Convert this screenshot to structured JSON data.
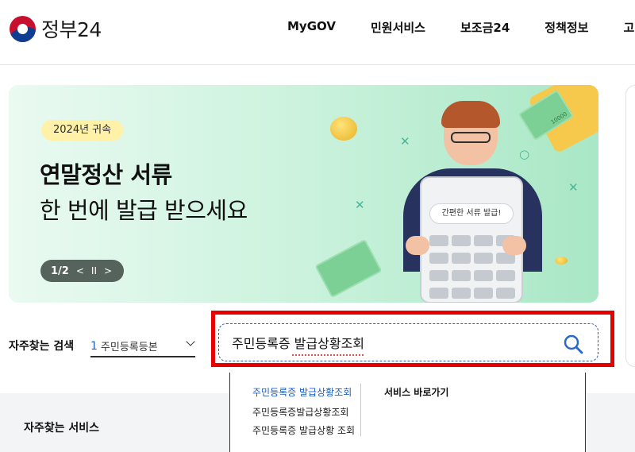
{
  "header": {
    "logo_text": "정부24",
    "nav": [
      "MyGOV",
      "민원서비스",
      "보조금24",
      "정책정보",
      "고"
    ]
  },
  "banner": {
    "badge": "2024년 귀속",
    "headline_bold": "연말정산 서류",
    "headline_regular": "한 번에 발급 받으세요",
    "pager": {
      "current": "1/2",
      "prev": "<",
      "pause": "II",
      "next": ">"
    },
    "calculator_text": "간편한 서류 발급!",
    "bill_value": "10000"
  },
  "search": {
    "frequent_label": "자주찾는 검색",
    "frequent_rank": "1",
    "frequent_value": "주민등록등본",
    "query": "주민등록증 발급상황조회",
    "highlight_color": "#e60000"
  },
  "dropdown": {
    "suggestions": [
      "주민등록증 발급상황조회",
      "주민등록증발급상황조회",
      "주민등록증 발급상황 조회"
    ],
    "shortcut_title": "서비스 바로가기"
  },
  "bottom": {
    "title": "자주찾는 서비스"
  }
}
